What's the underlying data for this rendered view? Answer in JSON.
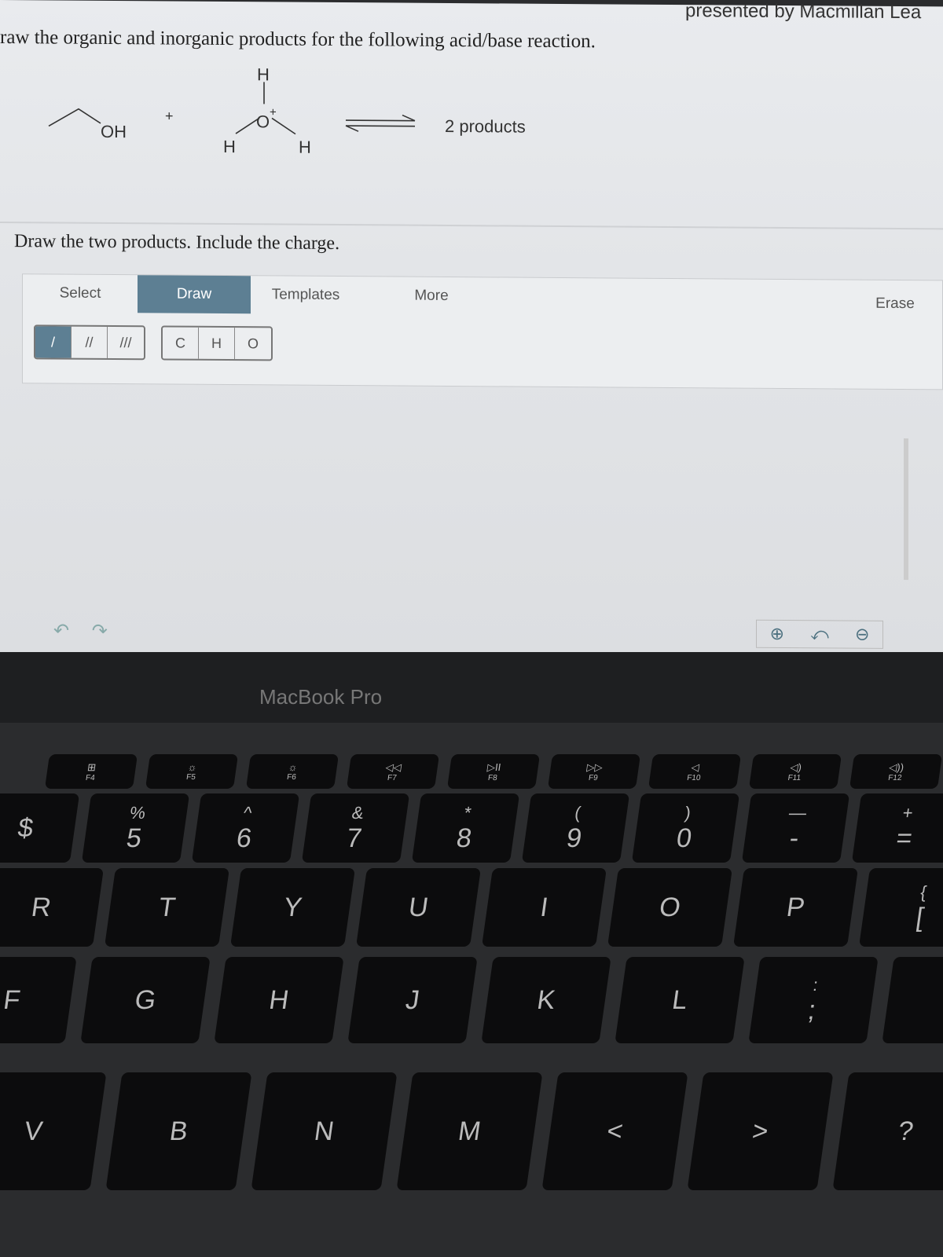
{
  "header": {
    "presenter": "presented by Macmillan Lea"
  },
  "question": {
    "prompt": "raw the organic and inorganic products for the following acid/base reaction.",
    "instruction": "Draw the two products. Include the charge."
  },
  "reaction": {
    "reactant1": "OH",
    "plus": "+",
    "h_top": "H",
    "oxonium": "O",
    "charge": "+",
    "h_left": "H",
    "h_right": "H",
    "products": "2 products"
  },
  "toolbar": {
    "tabs": [
      "Select",
      "Draw",
      "Templates",
      "More",
      "Erase"
    ],
    "active_tab": "Draw",
    "bonds": [
      "/",
      "//",
      "///"
    ],
    "atoms": [
      "C",
      "H",
      "O"
    ]
  },
  "canvas_controls": {
    "undo": "↶",
    "redo": "↷",
    "zoom_in": "⊕",
    "reset": "⤺",
    "zoom_out": "⊖"
  },
  "laptop": {
    "brand": "MacBook Pro"
  },
  "keys": [
    [
      "F4",
      "⊞"
    ],
    [
      "F5",
      "☼"
    ],
    [
      "F6",
      "☼"
    ],
    [
      "F7",
      "◁◁"
    ],
    [
      "F8",
      "▷II"
    ],
    [
      "F9",
      "▷▷"
    ],
    [
      "F10",
      "◁"
    ],
    [
      "F11",
      "◁)"
    ],
    [
      "F12",
      "◁))"
    ],
    [
      "$",
      ""
    ],
    [
      "5",
      "%"
    ],
    [
      "6",
      "^"
    ],
    [
      "7",
      "&"
    ],
    [
      "8",
      "*"
    ],
    [
      "9",
      "("
    ],
    [
      "0",
      ")"
    ],
    [
      "-",
      "—"
    ],
    [
      "=",
      "+"
    ],
    [
      "R",
      ""
    ],
    [
      "T",
      ""
    ],
    [
      "Y",
      ""
    ],
    [
      "U",
      ""
    ],
    [
      "I",
      ""
    ],
    [
      "O",
      ""
    ],
    [
      "P",
      ""
    ],
    [
      "[",
      "{"
    ],
    [
      "F",
      ""
    ],
    [
      "G",
      ""
    ],
    [
      "H",
      ""
    ],
    [
      "J",
      ""
    ],
    [
      "K",
      ""
    ],
    [
      "L",
      ""
    ],
    [
      ";",
      ":"
    ],
    [
      "'",
      "\""
    ],
    [
      "V",
      ""
    ],
    [
      "B",
      ""
    ],
    [
      "N",
      ""
    ],
    [
      "M",
      ""
    ],
    [
      "<",
      ""
    ],
    [
      ">",
      ""
    ],
    [
      "?",
      ""
    ]
  ]
}
